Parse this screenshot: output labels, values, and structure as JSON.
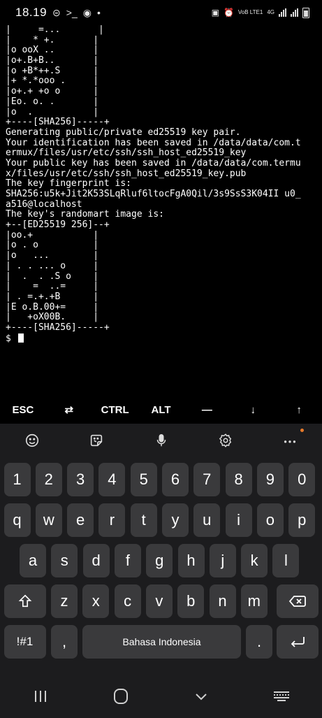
{
  "status_bar": {
    "time": "18.19",
    "icons": [
      "dnd-icon",
      "terminal-icon",
      "notification-icon",
      "dot"
    ],
    "right_icons": [
      "screenshot-icon",
      "alarm-icon",
      "volte-icon",
      "4g-icon",
      "signal-icon",
      "signal-icon",
      "battery-icon"
    ],
    "volte_label": "VoB LTE1",
    "net_label": "4G"
  },
  "terminal": {
    "lines": [
      "|     =...       |",
      "|    * +.       |",
      "|o ooX ..       |",
      "|o+.B+B..       |",
      "|o +B*++.S      |",
      "|+ *.*ooo .     |",
      "|o+.+ +o o      |",
      "|Eo. o. .       |",
      "|o  .           |",
      "+----[SHA256]-----+",
      "Generating public/private ed25519 key pair.",
      "Your identification has been saved in /data/data/com.t",
      "ermux/files/usr/etc/ssh/ssh_host_ed25519_key",
      "Your public key has been saved in /data/data/com.termu",
      "x/files/usr/etc/ssh/ssh_host_ed25519_key.pub",
      "The key fingerprint is:",
      "SHA256:u5k+Jit2K53SLqRluf6ltocFgA0Qil/3s9SsS3K04II u0_",
      "a516@localhost",
      "The key's randomart image is:",
      "+--[ED25519 256]--+",
      "|oo.+           |",
      "|o . o          |",
      "|o   ...        |",
      "| . . ... o     |",
      "|  .  . .S o    |",
      "|    =  ..=     |",
      "| . =.+.+B      |",
      "|E o.B.00+=     |",
      "|   +oX00B.     |",
      "+----[SHA256]-----+",
      "$ "
    ]
  },
  "extra_keys": [
    "ESC",
    "⇄",
    "CTRL",
    "ALT",
    "—",
    "↓",
    "↑"
  ],
  "keyboard": {
    "toolbar": [
      "emoji-icon",
      "sticker-icon",
      "microphone-icon",
      "settings-icon",
      "more-icon"
    ],
    "number_row": [
      "1",
      "2",
      "3",
      "4",
      "5",
      "6",
      "7",
      "8",
      "9",
      "0"
    ],
    "row1": [
      "q",
      "w",
      "e",
      "r",
      "t",
      "y",
      "u",
      "i",
      "o",
      "p"
    ],
    "row2": [
      "a",
      "s",
      "d",
      "f",
      "g",
      "h",
      "j",
      "k",
      "l"
    ],
    "row3": [
      "z",
      "x",
      "c",
      "v",
      "b",
      "n",
      "m"
    ],
    "symbols_label": "!#1",
    "comma_label": ",",
    "space_label": "Bahasa Indonesia",
    "period_label": "."
  },
  "nav_bar": [
    "recents-icon",
    "home-icon",
    "back-icon",
    "keyboard-hide-icon"
  ]
}
